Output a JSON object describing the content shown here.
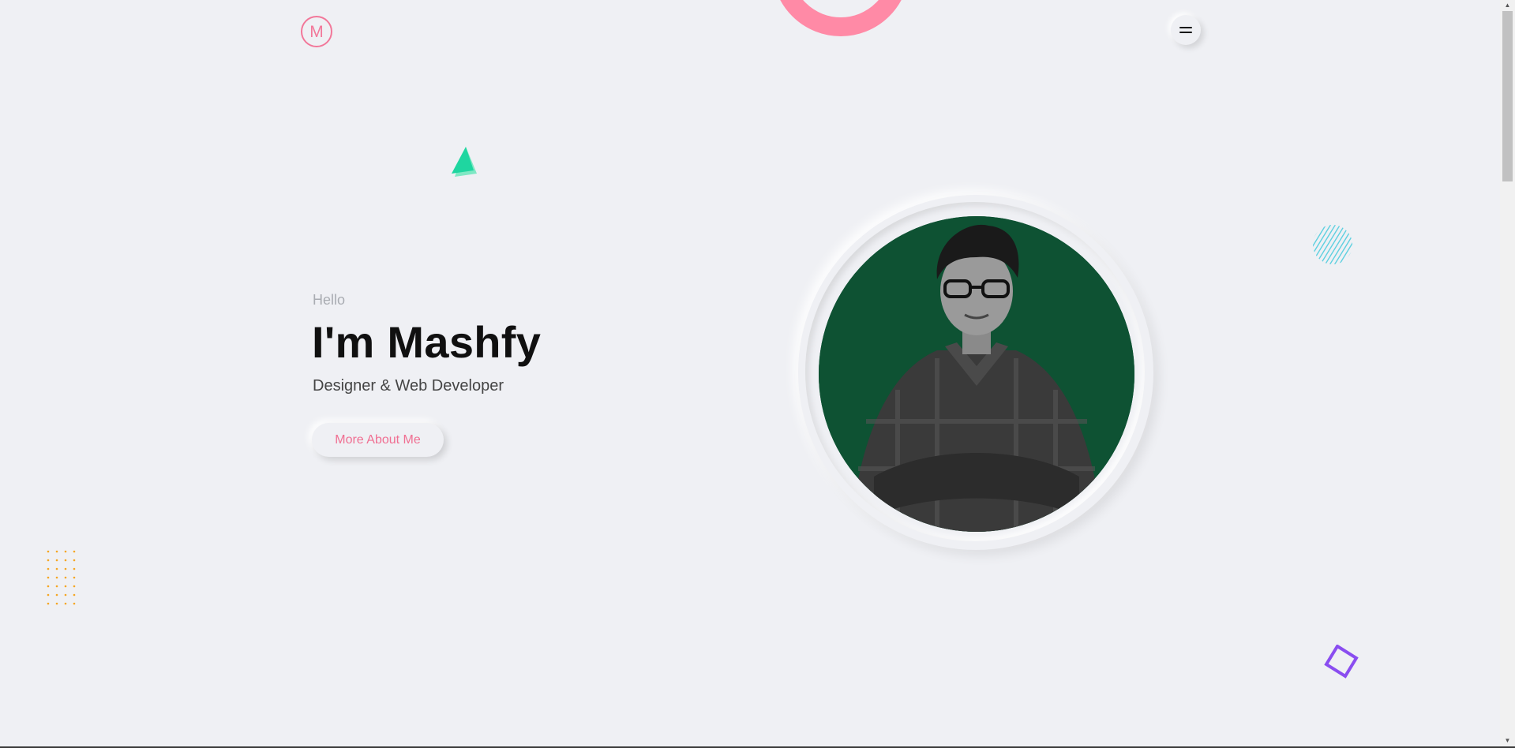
{
  "header": {
    "logo_letter": "M",
    "menu_icon": "hamburger-icon"
  },
  "hero": {
    "greeting": "Hello",
    "title": "I'm Mashfy",
    "subtitle": "Designer & Web Developer",
    "cta_label": "More About Me"
  },
  "portrait": {
    "background_color": "#0e5233"
  },
  "colors": {
    "accent": "#f06f92",
    "ring": "#ff8aa6",
    "triangle": "#1fd6a0",
    "stripes": "#5fd0e0",
    "dots": "#f5a623",
    "diamond": "#8a4df0",
    "background": "#eff0f4"
  },
  "decorations": [
    "ring-shape",
    "triangle-shape",
    "striped-circle-shape",
    "dot-grid-shape",
    "diamond-shape"
  ]
}
